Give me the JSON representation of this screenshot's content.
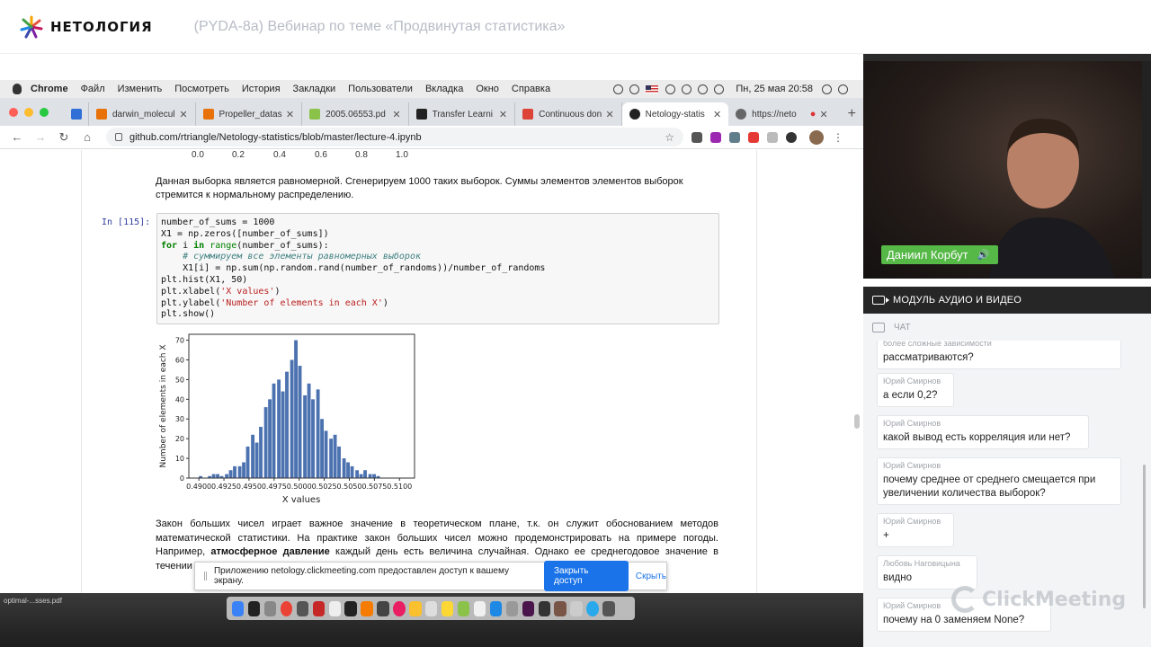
{
  "header": {
    "logo_text": "НЕТОЛОГИЯ",
    "webinar_title": "(PYDA-8a) Вебинар по теме «Продвинутая статистика»"
  },
  "mac_menu": {
    "items": [
      "Chrome",
      "Файл",
      "Изменить",
      "Посмотреть",
      "История",
      "Закладки",
      "Пользователи",
      "Вкладка",
      "Окно",
      "Справка"
    ],
    "datetime": "Пн, 25 мая  20:58"
  },
  "browser": {
    "tabs": [
      {
        "label": "darwin_molecul",
        "color": "#e8710a"
      },
      {
        "label": "Propeller_datas",
        "color": "#e8710a"
      },
      {
        "label": "2005.06553.pd",
        "color": "#8bc34a"
      },
      {
        "label": "Transfer Learni",
        "color": "#222222"
      },
      {
        "label": "Continuous don",
        "color": "#db4437"
      },
      {
        "label": "Netology-statis",
        "color": "#222222",
        "active": true
      },
      {
        "label": "https://neto",
        "color": "#666666"
      }
    ],
    "url": "github.com/rtriangle/Netology-statistics/blob/master/lecture-4.ipynb"
  },
  "notebook": {
    "top_ticks": [
      "0.0",
      "0.2",
      "0.4",
      "0.6",
      "0.8",
      "1.0"
    ],
    "md_text": "Данная выборка является равномерной. Сгенерируем 1000 таких выборок. Суммы элементов элементов выборок стремится к нормальному распределению.",
    "prompt": "In [115]:",
    "code_lines": {
      "l1": "number_of_sums = 1000",
      "l2": "X1 = np.zeros([number_of_sums])",
      "l3_kw1": "for",
      "l3_a": " i ",
      "l3_kw2": "in",
      "l3_bi": " range",
      "l3_b": "(number_of_sums):",
      "l4": "    # суммируем все элементы равномерных выборок",
      "l5": "    X1[i] = np.sum(np.random.rand(number_of_randoms))/number_of_randoms",
      "l6": "plt.hist(X1, 50)",
      "l7_a": "plt.xlabel(",
      "l7_s": "'X values'",
      "l7_b": ")",
      "l8_a": "plt.ylabel(",
      "l8_s": "'Number of elements in each X'",
      "l8_b": ")",
      "l9": "plt.show()"
    },
    "conclusion_part1": "Закон больших чисел играет важное значение в теоретическом плане, т.к. он служит обоснованием методов математической статистики. На практике закон больших чисел можно продемонстрировать на примере погоды. Например, ",
    "conclusion_bold": "атмосферное давление",
    "conclusion_part2": " каждый день есть величина случайная. Однако ее среднегодовое значение в течении многих лет практиче"
  },
  "chart_data": {
    "type": "bar",
    "xlabel": "X values",
    "ylabel": "Number of elements in each X",
    "xlim": [
      0.489,
      0.5115
    ],
    "ylim": [
      0,
      73
    ],
    "xticks": [
      "0.4900",
      "0.4925",
      "0.4950",
      "0.4975",
      "0.5000",
      "0.5025",
      "0.5050",
      "0.5075",
      "0.5100"
    ],
    "yticks": [
      "0",
      "10",
      "20",
      "30",
      "40",
      "50",
      "60",
      "70"
    ],
    "x": [
      0.4902,
      0.4906,
      0.4911,
      0.4915,
      0.4919,
      0.4923,
      0.4928,
      0.4932,
      0.4936,
      0.4941,
      0.4945,
      0.4949,
      0.4954,
      0.4958,
      0.4962,
      0.4967,
      0.4971,
      0.4975,
      0.498,
      0.4984,
      0.4988,
      0.4993,
      0.4997,
      0.5001,
      0.5006,
      0.501,
      0.5014,
      0.5019,
      0.5023,
      0.5027,
      0.5032,
      0.5036,
      0.504,
      0.5045,
      0.5049,
      0.5053,
      0.5058,
      0.5062,
      0.5066,
      0.5071,
      0.5075,
      0.5079,
      0.5084,
      0.5088,
      0.5092,
      0.5097,
      0.5101,
      0.5105,
      0.511,
      0.5114
    ],
    "values": [
      1,
      0,
      1,
      2,
      2,
      1,
      2,
      4,
      6,
      6,
      8,
      16,
      22,
      18,
      26,
      36,
      40,
      48,
      50,
      44,
      54,
      60,
      70,
      57,
      42,
      48,
      40,
      45,
      30,
      24,
      20,
      22,
      16,
      10,
      8,
      6,
      4,
      2,
      4,
      2,
      2,
      1,
      0,
      0,
      0,
      0,
      0,
      0,
      0,
      0
    ],
    "color": "#4c72b0"
  },
  "notice": {
    "text": "Приложению netology.clickmeeting.com предоставлен доступ к вашему экрану.",
    "primary": "Закрыть доступ",
    "secondary": "Скрыть"
  },
  "desktop": {
    "file": "optimal-...sses.pdf"
  },
  "video": {
    "speaker_name": "Даниил Корбут"
  },
  "module": {
    "label": "МОДУЛЬ АУДИО И ВИДЕО"
  },
  "chat": {
    "title": "ЧАТ",
    "messages": [
      {
        "author": "более сложные зависимости",
        "text": "рассматриваются?"
      },
      {
        "author": "Юрий Смирнов",
        "text": "а если 0,2?"
      },
      {
        "author": "Юрий Смирнов",
        "text": "какой вывод есть корреляция или нет?"
      },
      {
        "author": "Юрий Смирнов",
        "text": "почему среднее от среднего смещается при увеличении количества выборок?"
      },
      {
        "author": "Юрий Смирнов",
        "text": "+"
      },
      {
        "author": "Любовь Наговицына",
        "text": "видно"
      },
      {
        "author": "Юрий Смирнов",
        "text": "почему на 0 заменяем None?"
      }
    ],
    "watermark": "ClickMeeting"
  }
}
